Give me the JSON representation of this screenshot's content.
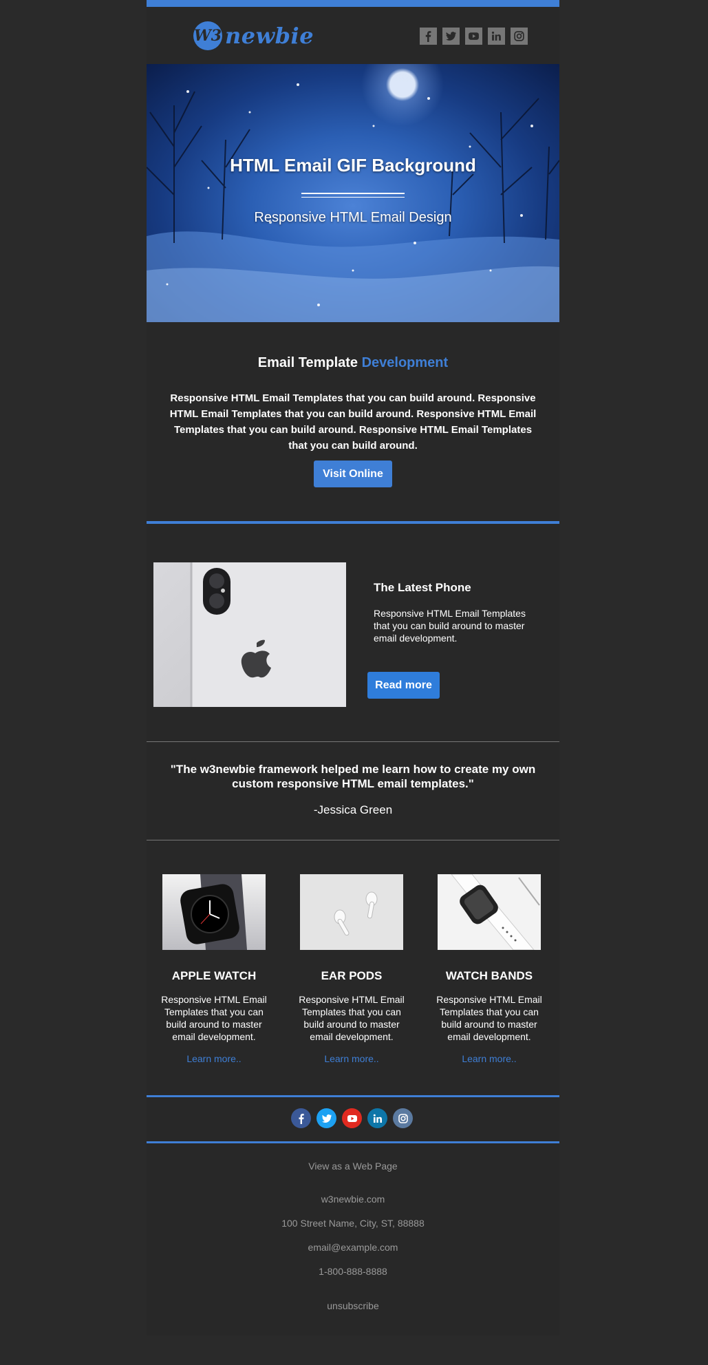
{
  "brand": {
    "logo_mark": "W3",
    "logo_text": "newbie"
  },
  "header_social": [
    "facebook-icon",
    "twitter-icon",
    "youtube-icon",
    "linkedin-icon",
    "instagram-icon"
  ],
  "hero": {
    "title": "HTML Email GIF Background",
    "subtitle": "Responsive HTML Email Design"
  },
  "intro": {
    "title_main": "Email Template",
    "title_accent": "Development",
    "text": "Responsive HTML Email Templates that you can build around. Responsive HTML Email Templates that you can build around. Responsive HTML Email Templates that you can build around. Responsive HTML Email Templates that you can build around.",
    "button": "Visit Online"
  },
  "feature": {
    "title": "The Latest Phone",
    "text": "Responsive HTML Email Templates that you can build around to master email development.",
    "button": "Read more"
  },
  "testimonial": {
    "quote": "\"The w3newbie framework helped me learn how to create my own custom responsive HTML email templates.\"",
    "author": "-Jessica Green"
  },
  "products": [
    {
      "title": "APPLE WATCH",
      "text": "Responsive HTML Email Templates that you can build around to master email development.",
      "link": "Learn more.."
    },
    {
      "title": "EAR PODS",
      "text": "Responsive HTML Email Templates that you can build around to master email development.",
      "link": "Learn more.."
    },
    {
      "title": "WATCH BANDS",
      "text": "Responsive HTML Email Templates that you can build around to master email development.",
      "link": "Learn more.."
    }
  ],
  "footer": {
    "social": [
      "facebook-icon",
      "twitter-icon",
      "youtube-icon",
      "linkedin-icon",
      "instagram-icon"
    ],
    "view_web": "View as a Web Page",
    "site": "w3newbie.com",
    "address": "100 Street Name, City, ST, 88888",
    "email": "email@example.com",
    "phone": "1-800-888-8888",
    "unsubscribe": "unsubscribe"
  },
  "colors": {
    "accent": "#3f7fd6",
    "background": "#2a2a2a",
    "panel": "#282828"
  }
}
